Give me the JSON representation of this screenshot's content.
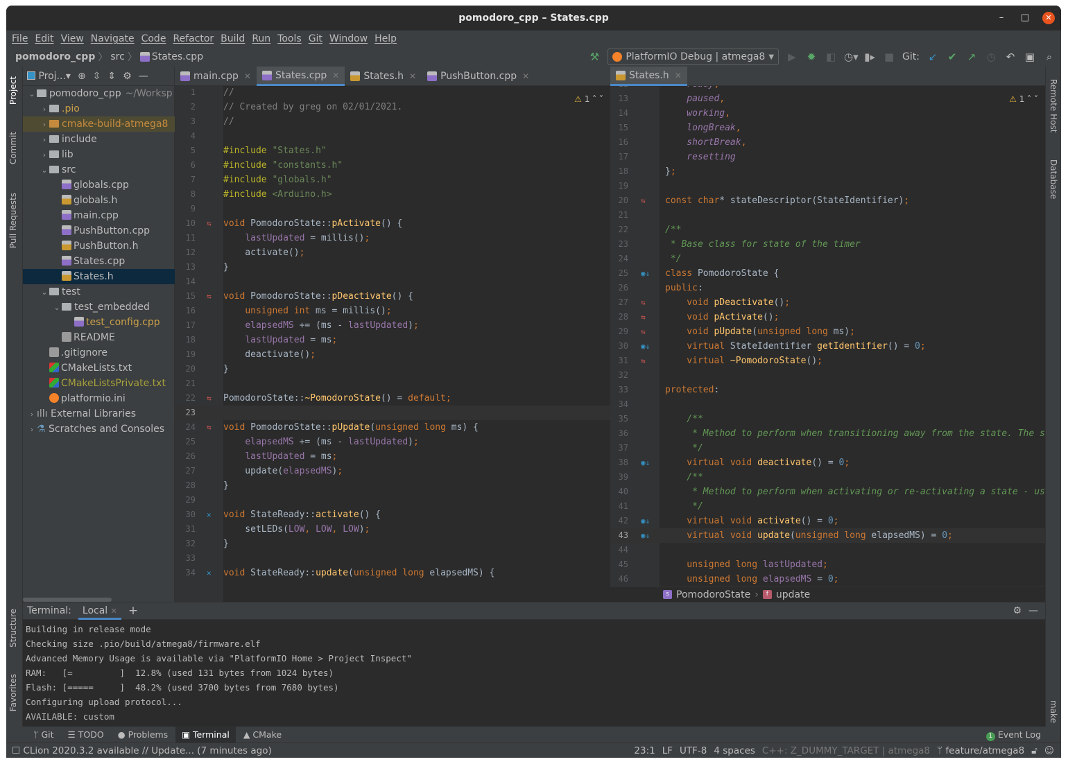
{
  "window": {
    "title": "pomodoro_cpp – States.cpp",
    "minimize": "–",
    "maximize": "□",
    "close": "✕"
  },
  "menu": [
    "File",
    "Edit",
    "View",
    "Navigate",
    "Code",
    "Refactor",
    "Build",
    "Run",
    "Tools",
    "Git",
    "Window",
    "Help"
  ],
  "breadcrumb": {
    "project": "pomodoro_cpp",
    "folder": "src",
    "file": "States.cpp"
  },
  "toolbar": {
    "run_config": "PlatformIO Debug | atmega8",
    "git_label": "Git:",
    "icons": [
      "hammer-icon",
      "run-icon",
      "debug-icon",
      "coverage-icon",
      "profile-icon",
      "attach-icon",
      "stop-icon",
      "git-update-icon",
      "git-commit-icon",
      "git-push-icon",
      "history-icon",
      "rollback-icon",
      "terminal-icon",
      "search-icon"
    ]
  },
  "left_strip": [
    "Project",
    "Commit",
    "Pull Requests",
    "Structure",
    "Favorites"
  ],
  "right_strip": [
    "Remote Host",
    "Database",
    "make"
  ],
  "project": {
    "label": "Proj...",
    "tree": [
      {
        "depth": 0,
        "arrow": "v",
        "type": "folder",
        "name": "pomodoro_cpp",
        "extra": "~/Worksp"
      },
      {
        "depth": 1,
        "arrow": ">",
        "type": "folder",
        "name": ".pio",
        "color": "#c9a04a"
      },
      {
        "depth": 1,
        "arrow": ">",
        "type": "folder-orange",
        "name": "cmake-build-atmega8",
        "color": "#c58a3e",
        "hl": true
      },
      {
        "depth": 1,
        "arrow": ">",
        "type": "folder",
        "name": "include"
      },
      {
        "depth": 1,
        "arrow": ">",
        "type": "folder",
        "name": "lib"
      },
      {
        "depth": 1,
        "arrow": "v",
        "type": "folder",
        "name": "src"
      },
      {
        "depth": 2,
        "type": "cpp",
        "name": "globals.cpp"
      },
      {
        "depth": 2,
        "type": "h",
        "name": "globals.h"
      },
      {
        "depth": 2,
        "type": "cpp",
        "name": "main.cpp"
      },
      {
        "depth": 2,
        "type": "cpp",
        "name": "PushButton.cpp"
      },
      {
        "depth": 2,
        "type": "h",
        "name": "PushButton.h"
      },
      {
        "depth": 2,
        "type": "cpp",
        "name": "States.cpp"
      },
      {
        "depth": 2,
        "type": "h",
        "name": "States.h",
        "sel": true
      },
      {
        "depth": 1,
        "arrow": "v",
        "type": "folder",
        "name": "test"
      },
      {
        "depth": 2,
        "arrow": "v",
        "type": "folder",
        "name": "test_embedded"
      },
      {
        "depth": 3,
        "type": "cpp",
        "name": "test_config.cpp",
        "color": "#c9a04a"
      },
      {
        "depth": 2,
        "type": "doc",
        "name": "README"
      },
      {
        "depth": 1,
        "type": "doc",
        "name": ".gitignore"
      },
      {
        "depth": 1,
        "type": "cmake",
        "name": "CMakeLists.txt"
      },
      {
        "depth": 1,
        "type": "cmake",
        "name": "CMakeListsPrivate.txt",
        "color": "#a6a03a"
      },
      {
        "depth": 1,
        "type": "pio",
        "name": "platformio.ini"
      },
      {
        "depth": 0,
        "arrow": ">",
        "type": "lib",
        "name": "External Libraries"
      },
      {
        "depth": 0,
        "arrow": ">",
        "type": "scratch",
        "name": "Scratches and Consoles"
      }
    ]
  },
  "left_editor": {
    "tabs": [
      {
        "label": "main.cpp",
        "type": "cpp"
      },
      {
        "label": "States.cpp",
        "type": "cpp",
        "active": true
      },
      {
        "label": "States.h",
        "type": "h"
      },
      {
        "label": "PushButton.cpp",
        "type": "cpp"
      }
    ],
    "inspections": "1",
    "first_line": 1,
    "current_line": 23,
    "lines": [
      [
        [
          "cm",
          "//"
        ]
      ],
      [
        [
          "cm",
          "// Created by greg on 02/01/2021."
        ]
      ],
      [
        [
          "cm",
          "//"
        ]
      ],
      [],
      [
        [
          "pp",
          "#include"
        ],
        [
          "str",
          " \"States.h\""
        ]
      ],
      [
        [
          "pp",
          "#include"
        ],
        [
          "str",
          " \"constants.h\""
        ]
      ],
      [
        [
          "pp",
          "#include"
        ],
        [
          "str",
          " \"globals.h\""
        ]
      ],
      [
        [
          "pp",
          "#include"
        ],
        [
          "str",
          " <Arduino.h>"
        ]
      ],
      [],
      {
        "mark": "swap",
        "t": [
          [
            "kw",
            "void"
          ],
          [
            "pl",
            " PomodoroState::"
          ],
          [
            "fn",
            "pActivate"
          ],
          [
            "pl",
            "() {"
          ]
        ]
      },
      [
        [
          "pl",
          "    "
        ],
        [
          "var",
          "lastUpdated"
        ],
        [
          "pl",
          " = millis()"
        ],
        [
          "kw",
          ";"
        ]
      ],
      [
        [
          "pl",
          "    activate()"
        ],
        [
          "kw",
          ";"
        ]
      ],
      [
        [
          "pl",
          "}"
        ]
      ],
      [],
      {
        "mark": "swap",
        "t": [
          [
            "kw",
            "void"
          ],
          [
            "pl",
            " PomodoroState::"
          ],
          [
            "fn",
            "pDeactivate"
          ],
          [
            "pl",
            "() {"
          ]
        ]
      },
      [
        [
          "pl",
          "    "
        ],
        [
          "kw",
          "unsigned int"
        ],
        [
          "pl",
          " ms = millis()"
        ],
        [
          "kw",
          ";"
        ]
      ],
      [
        [
          "pl",
          "    "
        ],
        [
          "var",
          "elapsedMS"
        ],
        [
          "pl",
          " += (ms - "
        ],
        [
          "var",
          "lastUpdated"
        ],
        [
          "pl",
          ")"
        ],
        [
          "kw",
          ";"
        ]
      ],
      [
        [
          "pl",
          "    "
        ],
        [
          "var",
          "lastUpdated"
        ],
        [
          "pl",
          " = ms"
        ],
        [
          "kw",
          ";"
        ]
      ],
      [
        [
          "pl",
          "    deactivate()"
        ],
        [
          "kw",
          ";"
        ]
      ],
      [
        [
          "pl",
          "}"
        ]
      ],
      [],
      {
        "mark": "swap",
        "t": [
          [
            "pl",
            "PomodoroState::"
          ],
          [
            "fn",
            "~PomodoroState"
          ],
          [
            "pl",
            "() = "
          ],
          [
            "kw",
            "default;"
          ]
        ]
      },
      [],
      {
        "mark": "swap",
        "t": [
          [
            "kw",
            "void"
          ],
          [
            "pl",
            " PomodoroState::"
          ],
          [
            "fn",
            "pUpdate"
          ],
          [
            "pl",
            "("
          ],
          [
            "kw",
            "unsigned long"
          ],
          [
            "pl",
            " ms) {"
          ]
        ]
      },
      [
        [
          "pl",
          "    "
        ],
        [
          "var",
          "elapsedMS"
        ],
        [
          "pl",
          " += (ms - "
        ],
        [
          "var",
          "lastUpdated"
        ],
        [
          "pl",
          ")"
        ],
        [
          "kw",
          ";"
        ]
      ],
      [
        [
          "pl",
          "    "
        ],
        [
          "var",
          "lastUpdated"
        ],
        [
          "pl",
          " = ms"
        ],
        [
          "kw",
          ";"
        ]
      ],
      [
        [
          "pl",
          "    update("
        ],
        [
          "var",
          "elapsedMS"
        ],
        [
          "pl",
          ")"
        ],
        [
          "kw",
          ";"
        ]
      ],
      [
        [
          "pl",
          "}"
        ]
      ],
      [],
      {
        "mark": "impl",
        "t": [
          [
            "kw",
            "void"
          ],
          [
            "pl",
            " StateReady::"
          ],
          [
            "fn",
            "activate"
          ],
          [
            "pl",
            "() {"
          ]
        ]
      },
      [
        [
          "pl",
          "    setLEDs("
        ],
        [
          "var",
          "LOW"
        ],
        [
          "kw",
          ", "
        ],
        [
          "var",
          "LOW"
        ],
        [
          "kw",
          ", "
        ],
        [
          "var",
          "LOW"
        ],
        [
          "pl",
          ")"
        ],
        [
          "kw",
          ";"
        ]
      ],
      [
        [
          "pl",
          "}"
        ]
      ],
      [],
      {
        "mark": "impl",
        "t": [
          [
            "kw",
            "void"
          ],
          [
            "pl",
            " StateReady::"
          ],
          [
            "fn",
            "update"
          ],
          [
            "pl",
            "("
          ],
          [
            "kw",
            "unsigned long"
          ],
          [
            "pl",
            " elapsedMS) {"
          ]
        ]
      }
    ]
  },
  "right_editor": {
    "tabs": [
      {
        "label": "States.h",
        "type": "h",
        "active": true
      }
    ],
    "inspections": "1",
    "first_line": 12,
    "current_line": 43,
    "lines": [
      [
        [
          "en",
          "    ready"
        ],
        [
          "kw",
          ","
        ]
      ],
      [
        [
          "en",
          "    paused"
        ],
        [
          "kw",
          ","
        ]
      ],
      [
        [
          "en",
          "    working"
        ],
        [
          "kw",
          ","
        ]
      ],
      [
        [
          "en",
          "    longBreak"
        ],
        [
          "kw",
          ","
        ]
      ],
      [
        [
          "en",
          "    shortBreak"
        ],
        [
          "kw",
          ","
        ]
      ],
      [
        [
          "en",
          "    resetting"
        ]
      ],
      [
        [
          "pl",
          "}"
        ],
        [
          "kw",
          ";"
        ]
      ],
      [],
      {
        "mark": "swap",
        "t": [
          [
            "kw",
            "const char"
          ],
          [
            "pl",
            "* stateDescriptor(StateIdentifier)"
          ],
          [
            "kw",
            ";"
          ]
        ]
      },
      [],
      [
        [
          "doc",
          "/**"
        ]
      ],
      [
        [
          "doc",
          " * Base class for state of the timer"
        ]
      ],
      [
        [
          "doc",
          " */"
        ]
      ],
      {
        "mark": "over",
        "t": [
          [
            "kw",
            "class"
          ],
          [
            "pl",
            " PomodoroState {"
          ]
        ]
      },
      [
        [
          "kw",
          "public"
        ],
        [
          "pl",
          ":"
        ]
      ],
      {
        "mark": "swap",
        "t": [
          [
            "kw",
            "    void "
          ],
          [
            "fn",
            "pDeactivate"
          ],
          [
            "pl",
            "()"
          ],
          [
            "kw",
            ";"
          ]
        ]
      },
      {
        "mark": "swap",
        "t": [
          [
            "kw",
            "    void "
          ],
          [
            "fn",
            "pActivate"
          ],
          [
            "pl",
            "()"
          ],
          [
            "kw",
            ";"
          ]
        ]
      },
      {
        "mark": "swap",
        "t": [
          [
            "kw",
            "    void "
          ],
          [
            "fn",
            "pUpdate"
          ],
          [
            "pl",
            "("
          ],
          [
            "kw",
            "unsigned long"
          ],
          [
            "pl",
            " ms)"
          ],
          [
            "kw",
            ";"
          ]
        ]
      },
      {
        "mark": "over",
        "t": [
          [
            "kw",
            "    virtual"
          ],
          [
            "pl",
            " StateIdentifier "
          ],
          [
            "fn",
            "getIdentifier"
          ],
          [
            "pl",
            "() = "
          ],
          [
            "num",
            "0"
          ],
          [
            "kw",
            ";"
          ]
        ]
      },
      {
        "mark": "swap",
        "t": [
          [
            "kw",
            "    virtual"
          ],
          [
            "pl",
            " "
          ],
          [
            "fn",
            "~PomodoroState"
          ],
          [
            "pl",
            "()"
          ],
          [
            "kw",
            ";"
          ]
        ]
      },
      [],
      [
        [
          "kw",
          "protected"
        ],
        [
          "pl",
          ":"
        ]
      ],
      [],
      [
        [
          "doc",
          "    /**"
        ]
      ],
      [
        [
          "doc",
          "     * Method to perform when transitioning away from the state. The s"
        ]
      ],
      [
        [
          "doc",
          "     */"
        ]
      ],
      {
        "mark": "over",
        "t": [
          [
            "kw",
            "    virtual void "
          ],
          [
            "fn",
            "deactivate"
          ],
          [
            "pl",
            "() = "
          ],
          [
            "num",
            "0"
          ],
          [
            "kw",
            ";"
          ]
        ]
      },
      [
        [
          "doc",
          "    /**"
        ]
      ],
      [
        [
          "doc",
          "     * Method to perform when activating or re-activating a state - us"
        ]
      ],
      [
        [
          "doc",
          "     */"
        ]
      ],
      {
        "mark": "over",
        "t": [
          [
            "kw",
            "    virtual void "
          ],
          [
            "fn",
            "activate"
          ],
          [
            "pl",
            "() = "
          ],
          [
            "num",
            "0"
          ],
          [
            "kw",
            ";"
          ]
        ]
      },
      {
        "mark": "over",
        "t": [
          [
            "kw",
            "    virtual void "
          ],
          [
            "fn",
            "update"
          ],
          [
            "pl",
            "("
          ],
          [
            "kw",
            "unsigned long"
          ],
          [
            "pl",
            " elapsedMS) = "
          ],
          [
            "num",
            "0"
          ],
          [
            "kw",
            ";"
          ]
        ]
      },
      [],
      [
        [
          "kw",
          "    unsigned long "
        ],
        [
          "var",
          "lastUpdated"
        ],
        [
          "kw",
          ";"
        ]
      ],
      [
        [
          "kw",
          "    unsigned long "
        ],
        [
          "var",
          "elapsedMS"
        ],
        [
          "pl",
          " = "
        ],
        [
          "num",
          "0"
        ],
        [
          "kw",
          ";"
        ]
      ]
    ],
    "crumbs": [
      {
        "badge": "s",
        "label": "PomodoroState"
      },
      {
        "badge": "f",
        "label": "update"
      }
    ]
  },
  "terminal": {
    "label": "Terminal:",
    "tab": "Local",
    "add": "+",
    "lines": [
      "Building in release mode",
      "Checking size .pio/build/atmega8/firmware.elf",
      "Advanced Memory Usage is available via \"PlatformIO Home > Project Inspect\"",
      "RAM:   [=         ]  12.8% (used 131 bytes from 1024 bytes)",
      "Flash: [=====     ]  48.2% (used 3700 bytes from 7680 bytes)",
      "Configuring upload protocol...",
      "AVAILABLE: custom"
    ]
  },
  "tool_windows": [
    {
      "label": "Git",
      "icon": "git-branch-icon"
    },
    {
      "label": "TODO",
      "icon": "list-icon"
    },
    {
      "label": "Problems",
      "icon": "problems-icon"
    },
    {
      "label": "Terminal",
      "icon": "terminal-icon",
      "active": true
    },
    {
      "label": "CMake",
      "icon": "cmake-icon"
    }
  ],
  "event_log": {
    "label": "Event Log",
    "count": "1"
  },
  "status": {
    "message": "CLion 2020.3.2 available // Update... (7 minutes ago)",
    "position": "23:1",
    "line_sep": "LF",
    "encoding": "UTF-8",
    "indent": "4 spaces",
    "context": "C++: Z_DUMMY_TARGET | atmega8",
    "branch": "feature/atmega8"
  },
  "colors": {
    "accent": "#4a88c7",
    "keyword": "#cc7832",
    "function": "#ffc66d",
    "field": "#9876aa",
    "string": "#6a8759",
    "doc": "#629755"
  }
}
